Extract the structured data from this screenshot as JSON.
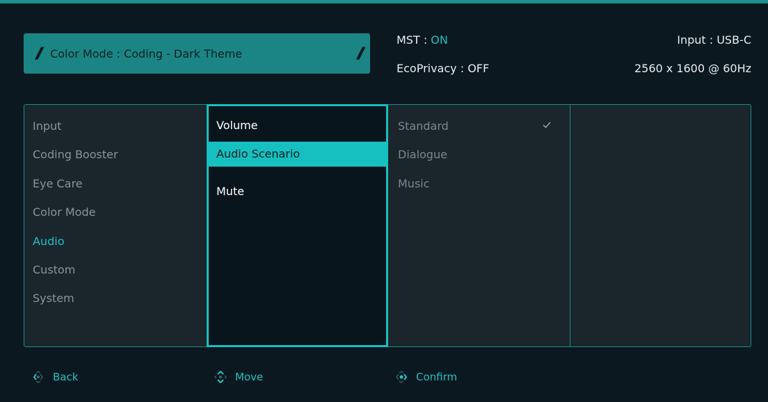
{
  "header": {
    "color_mode_label": "Color Mode : Coding - Dark Theme",
    "mst_label": "MST : ",
    "mst_value": "ON",
    "ecoprivacy": "EcoPrivacy : OFF",
    "input": "Input : USB-C",
    "resolution": "2560 x 1600 @ 60Hz"
  },
  "menu": {
    "categories": [
      "Input",
      "Coding Booster",
      "Eye Care",
      "Color Mode",
      "Audio",
      "Custom",
      "System"
    ],
    "active_category": "Audio",
    "submenu": [
      "Volume",
      "Audio Scenario",
      "Mute"
    ],
    "selected_submenu": "Audio Scenario",
    "options": [
      "Standard",
      "Dialogue",
      "Music"
    ],
    "checked_option": "Standard"
  },
  "footer": {
    "back": "Back",
    "move": "Move",
    "confirm": "Confirm"
  },
  "colors": {
    "accent": "#17c0c0",
    "background": "#0b1820",
    "panel": "#1a252c"
  }
}
